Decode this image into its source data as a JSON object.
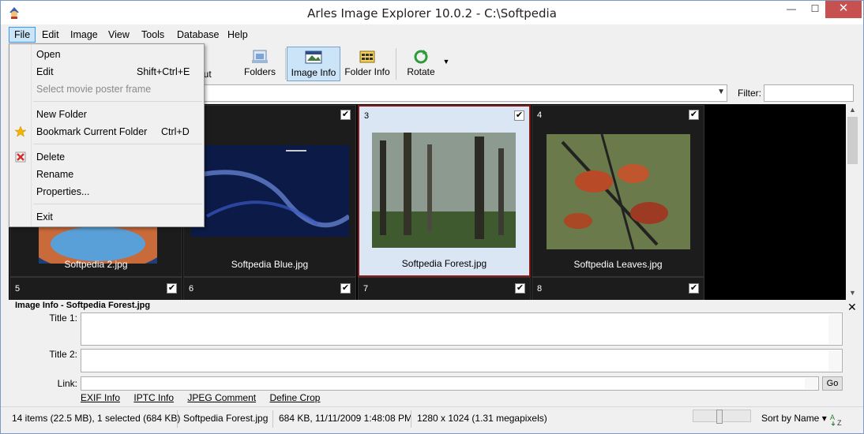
{
  "window": {
    "title": "Arles Image Explorer 10.0.2 - C:\\Softpedia",
    "minimize": "—",
    "maximize": "☐",
    "close": "✕"
  },
  "menubar": [
    "File",
    "Edit",
    "Image",
    "View",
    "Tools",
    "Database",
    "Help"
  ],
  "toolbar": {
    "about_partial": "out",
    "folders": "Folders",
    "image_info": "Image Info",
    "folder_info": "Folder Info",
    "rotate": "Rotate"
  },
  "filter": {
    "label": "Filter:",
    "value": ""
  },
  "thumbnails": [
    {
      "num": "",
      "caption": "Softpedia 2.jpg",
      "checked": true
    },
    {
      "num": "",
      "caption": "Softpedia Blue.jpg",
      "checked": true
    },
    {
      "num": "3",
      "caption": "Softpedia Forest.jpg",
      "checked": true,
      "selected": true
    },
    {
      "num": "4",
      "caption": "Softpedia Leaves.jpg",
      "checked": true
    }
  ],
  "thumbnails_row2": [
    {
      "num": "5",
      "checked": true
    },
    {
      "num": "6",
      "checked": true
    },
    {
      "num": "7",
      "checked": true
    },
    {
      "num": "8",
      "checked": true
    }
  ],
  "checkmark": "✔",
  "info_panel": {
    "title": "Image Info - Softpedia Forest.jpg",
    "title1_label": "Title 1:",
    "title2_label": "Title 2:",
    "link_label": "Link:",
    "go": "Go",
    "tabs": [
      "EXIF Info",
      "IPTC Info",
      "JPEG Comment",
      "Define Crop"
    ]
  },
  "status": {
    "items": "14 items (22.5 MB), 1 selected (684 KB)",
    "file": "Softpedia Forest.jpg",
    "size_date": "684 KB, 11/11/2009 1:48:08 PM",
    "dims": "1280 x 1024 (1.31 megapixels)",
    "sort": "Sort by Name ▾",
    "zoom_level": 0.45
  },
  "file_menu": [
    {
      "label": "Open",
      "shortcut": ""
    },
    {
      "label": "Edit",
      "shortcut": "Shift+Ctrl+E"
    },
    {
      "label": "Select movie poster frame",
      "shortcut": "",
      "disabled": true
    },
    {
      "label": "New Folder",
      "shortcut": ""
    },
    {
      "label": "Bookmark Current Folder",
      "shortcut": "Ctrl+D",
      "icon": "star-icon"
    },
    {
      "label": "Delete",
      "shortcut": "",
      "icon": "delete-icon"
    },
    {
      "label": "Rename",
      "shortcut": ""
    },
    {
      "label": "Properties...",
      "shortcut": ""
    },
    {
      "label": "Exit",
      "shortcut": ""
    }
  ],
  "colors": {
    "selection_border": "#8b1a1a",
    "close_button": "#c75050",
    "menu_highlight": "#cce4f7"
  }
}
